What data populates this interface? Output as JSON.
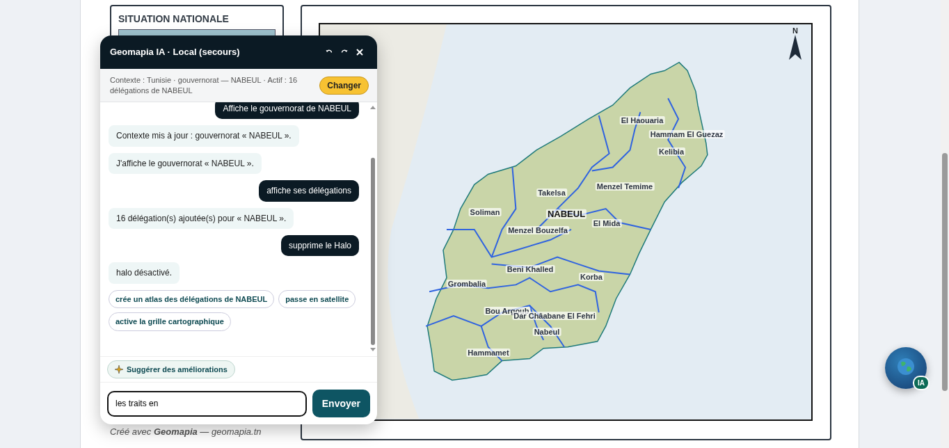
{
  "left_card": {
    "title": "SITUATION NATIONALE"
  },
  "map": {
    "north": "N",
    "labels": [
      {
        "text": "El Haouaria",
        "kind": "delegation"
      },
      {
        "text": "Hammam El Guezaz",
        "kind": "delegation"
      },
      {
        "text": "Kelibia",
        "kind": "delegation"
      },
      {
        "text": "Menzel Temime",
        "kind": "delegation"
      },
      {
        "text": "Takelsa",
        "kind": "delegation"
      },
      {
        "text": "Soliman",
        "kind": "delegation"
      },
      {
        "text": "NABEUL",
        "kind": "governorate"
      },
      {
        "text": "El Mida",
        "kind": "delegation"
      },
      {
        "text": "Menzel Bouzelfa",
        "kind": "delegation"
      },
      {
        "text": "Beni Khalled",
        "kind": "delegation"
      },
      {
        "text": "Korba",
        "kind": "delegation"
      },
      {
        "text": "Grombalia",
        "kind": "delegation"
      },
      {
        "text": "Bou Argoub",
        "kind": "delegation"
      },
      {
        "text": "Dar Châabane El Fehri",
        "kind": "delegation"
      },
      {
        "text": "Nabeul",
        "kind": "delegation"
      },
      {
        "text": "Hammamet",
        "kind": "delegation"
      }
    ]
  },
  "footer": "Créé avec **Geomapia** — geomapia.tn",
  "chat": {
    "title": "Geomapia IA · Local (secours)",
    "context": "Contexte : Tunisie · gouvernorat — NABEUL · Actif : 16 délégations de NABEUL",
    "change_button": "Changer",
    "messages": [
      {
        "kind": "user",
        "text": "Affiche le gouvernorat de NABEUL"
      },
      {
        "kind": "bot",
        "text": "Contexte mis à jour : gouvernorat « NABEUL »."
      },
      {
        "kind": "bot",
        "text": "J'affiche le gouvernorat « NABEUL »."
      },
      {
        "kind": "user",
        "text": "affiche ses délégations"
      },
      {
        "kind": "bot",
        "text": "16 délégation(s) ajoutée(s) pour « NABEUL »."
      },
      {
        "kind": "user",
        "text": "supprime le Halo"
      },
      {
        "kind": "bot",
        "text": "halo désactivé."
      }
    ],
    "suggestions": [
      "crée un atlas des délégations de NABEUL",
      "passe en satellite",
      "active la grille cartographique"
    ],
    "improve_button": "Suggérer des améliorations",
    "input": {
      "value": "les traits en"
    },
    "send_button": "Envoyer"
  },
  "fab": {
    "badge": "IA"
  }
}
